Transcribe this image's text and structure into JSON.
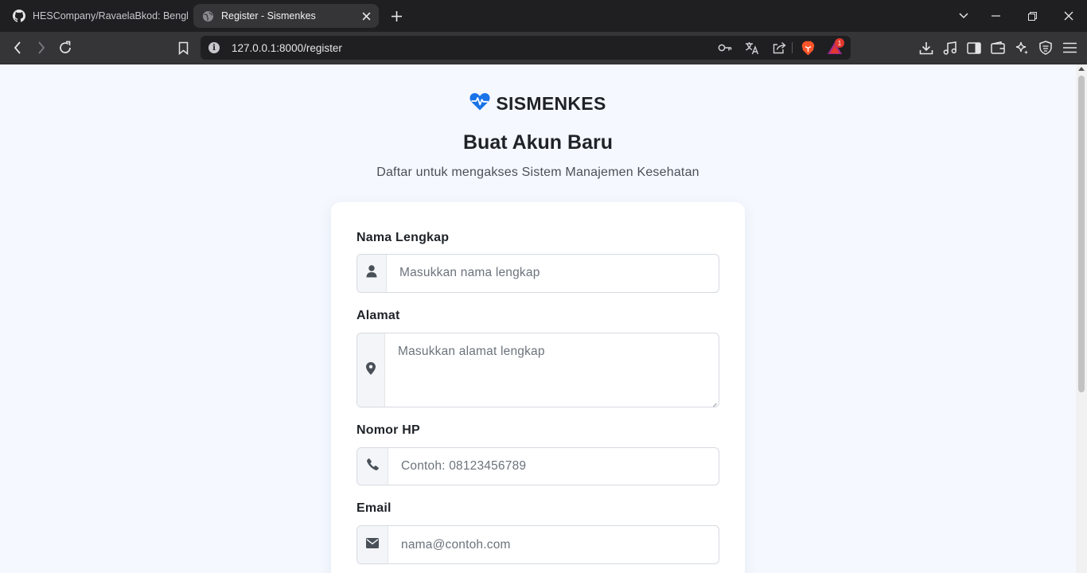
{
  "browser": {
    "tabs": [
      {
        "title": "HESCompany/RavaelaBkod: Bengko",
        "icon": "github-icon",
        "active": false
      },
      {
        "title": "Register - Sismenkes",
        "icon": "globe-icon",
        "active": true
      }
    ],
    "url": "127.0.0.1:8000/register",
    "notification_count": "1"
  },
  "brand": {
    "name": "SISMENKES",
    "icon": "heartbeat-icon",
    "color": "#1a73e8"
  },
  "page": {
    "title": "Buat Akun Baru",
    "subtitle": "Daftar untuk mengakses Sistem Manajemen Kesehatan"
  },
  "form": {
    "name": {
      "label": "Nama Lengkap",
      "placeholder": "Masukkan nama lengkap",
      "icon": "user-icon"
    },
    "address": {
      "label": "Alamat",
      "placeholder": "Masukkan alamat lengkap",
      "icon": "map-pin-icon"
    },
    "phone": {
      "label": "Nomor HP",
      "placeholder": "Contoh: 08123456789",
      "icon": "phone-icon"
    },
    "email": {
      "label": "Email",
      "placeholder": "nama@contoh.com",
      "icon": "envelope-icon"
    }
  }
}
